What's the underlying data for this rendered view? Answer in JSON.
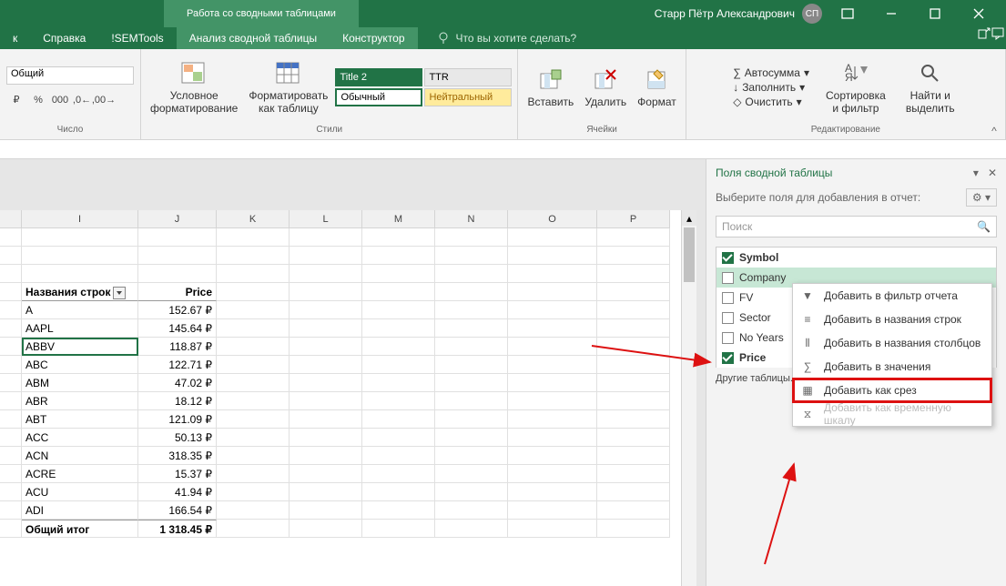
{
  "titlebar": {
    "context_label": "Работа со сводными таблицами",
    "user": "Старр Пётр Александрович",
    "avatar": "СП"
  },
  "tabs": {
    "help": "Справка",
    "semtools": "!SEMTools",
    "analyze": "Анализ сводной таблицы",
    "design": "Конструктор",
    "tell_me": "Что вы хотите сделать?"
  },
  "ribbon": {
    "number": {
      "format": "Общий",
      "group": "Число"
    },
    "styles": {
      "cond_fmt": "Условное\nформатирование",
      "as_table": "Форматировать\nкак таблицу",
      "title2": "Title 2",
      "ttr": "TTR",
      "normal": "Обычный",
      "neutral": "Нейтральный",
      "group": "Стили"
    },
    "cells": {
      "insert": "Вставить",
      "delete": "Удалить",
      "format": "Формат",
      "group": "Ячейки"
    },
    "editing": {
      "autosum": "Автосумма",
      "fill": "Заполнить",
      "clear": "Очистить",
      "sort": "Сортировка\nи фильтр",
      "find": "Найти и\nвыделить",
      "group": "Редактирование"
    }
  },
  "columns": [
    "I",
    "J",
    "K",
    "L",
    "M",
    "N",
    "O",
    "P"
  ],
  "table": {
    "header_label": "Названия строк",
    "price": "Price",
    "rows": [
      {
        "n": "A",
        "p": "152.67 ₽"
      },
      {
        "n": "AAPL",
        "p": "145.64 ₽"
      },
      {
        "n": "ABBV",
        "p": "118.87 ₽"
      },
      {
        "n": "ABC",
        "p": "122.71 ₽"
      },
      {
        "n": "ABM",
        "p": "47.02 ₽"
      },
      {
        "n": "ABR",
        "p": "18.12 ₽"
      },
      {
        "n": "ABT",
        "p": "121.09 ₽"
      },
      {
        "n": "ACC",
        "p": "50.13 ₽"
      },
      {
        "n": "ACN",
        "p": "318.35 ₽"
      },
      {
        "n": "ACRE",
        "p": "15.37 ₽"
      },
      {
        "n": "ACU",
        "p": "41.94 ₽"
      },
      {
        "n": "ADI",
        "p": "166.54 ₽"
      }
    ],
    "total_label": "Общий итог",
    "total_val": "1 318.45 ₽"
  },
  "pane": {
    "title": "Поля сводной таблицы",
    "subtitle": "Выберите поля для добавления в отчет:",
    "search": "Поиск",
    "fields": [
      {
        "name": "Symbol",
        "checked": true,
        "bold": true
      },
      {
        "name": "Company",
        "checked": false,
        "sel": true
      },
      {
        "name": "FV",
        "checked": false
      },
      {
        "name": "Sector",
        "checked": false
      },
      {
        "name": "No Years",
        "checked": false
      },
      {
        "name": "Price",
        "checked": true,
        "bold": true
      }
    ],
    "other": "Другие таблицы..."
  },
  "ctx": {
    "filter": "Добавить в фильтр отчета",
    "rows": "Добавить в названия строк",
    "cols": "Добавить в названия столбцов",
    "values": "Добавить в значения",
    "slicer": "Добавить как срез",
    "timeline": "Добавить как временную шкалу"
  }
}
